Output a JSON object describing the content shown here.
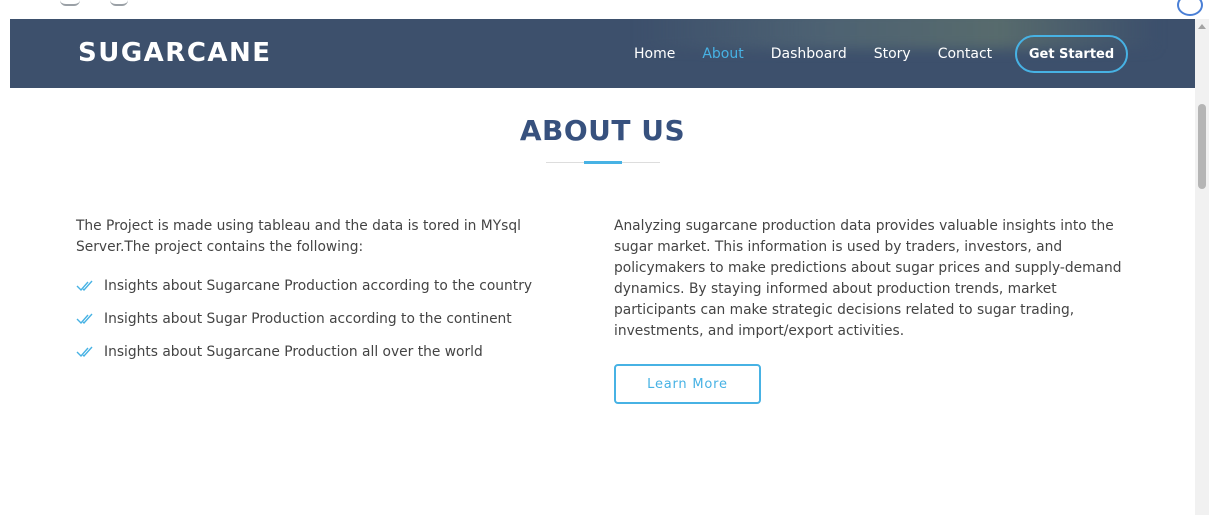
{
  "header": {
    "logo": "SUGARCANE",
    "nav": [
      "Home",
      "About",
      "Dashboard",
      "Story",
      "Contact"
    ],
    "active_nav": "About",
    "cta_label": "Get Started"
  },
  "about": {
    "title": "ABOUT US",
    "left_intro": "The Project is made using tableau and the data is tored in MYsql Server.The project contains the following:",
    "items": [
      "Insights about Sugarcane Production according to the country",
      "Insights about Sugar Production according to the continent",
      "Insights about Sugarcane Production all over the world"
    ],
    "right_text": "Analyzing sugarcane production data provides valuable insights into the sugar market. This information is used by traders, investors, and policymakers to make predictions about sugar prices and supply-demand dynamics. By staying informed about production trends, market participants can make strategic decisions related to sugar trading, investments, and import/export activities.",
    "learn_more_label": "Learn More"
  },
  "colors": {
    "header_bg": "#3d506c",
    "accent": "#47b2e4",
    "title": "#37517e",
    "body_text": "#444444"
  },
  "icons": {
    "list_bullet": "double-check-icon"
  }
}
